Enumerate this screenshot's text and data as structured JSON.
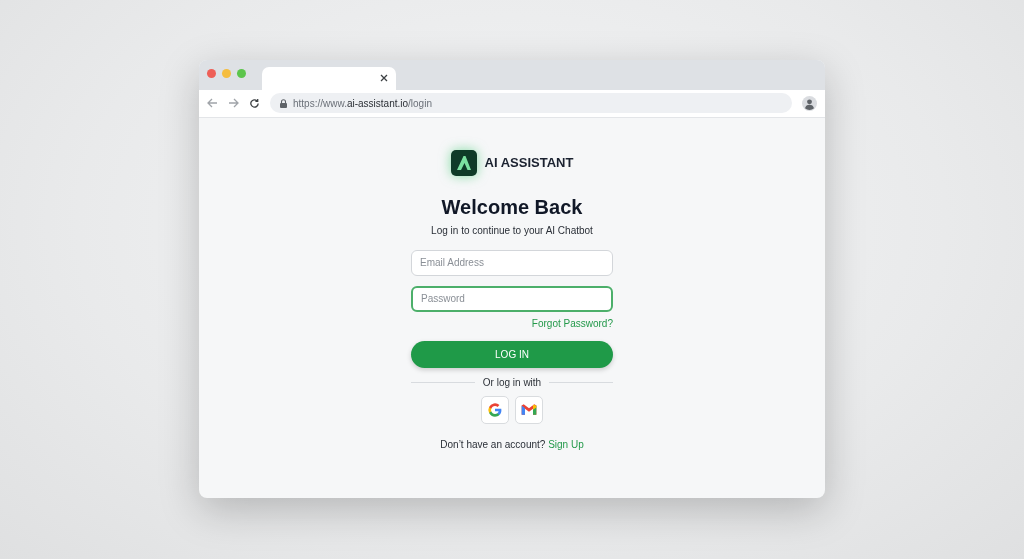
{
  "browser": {
    "tab": {
      "selected": true
    },
    "url": "https://www.**ai-assistant.io**/login"
  },
  "brand": {
    "name": "AI ASSISTANT"
  },
  "heading": "Welcome Back",
  "subheading": "Log in to continue to your AI Chatbot",
  "fields": [
    {
      "placeholder": "Email Address",
      "focused": false
    },
    {
      "placeholder": "Password",
      "focused": true
    }
  ],
  "forgot_link": "Forgot Password?",
  "login_button": "LOG IN",
  "divider_text": "Or log in with",
  "social_buttons": [
    {
      "kind": "google"
    },
    {
      "kind": "gmail"
    }
  ],
  "signup_prompt": {
    "text": "Don’t have an account?",
    "link": "Sign Up"
  }
}
